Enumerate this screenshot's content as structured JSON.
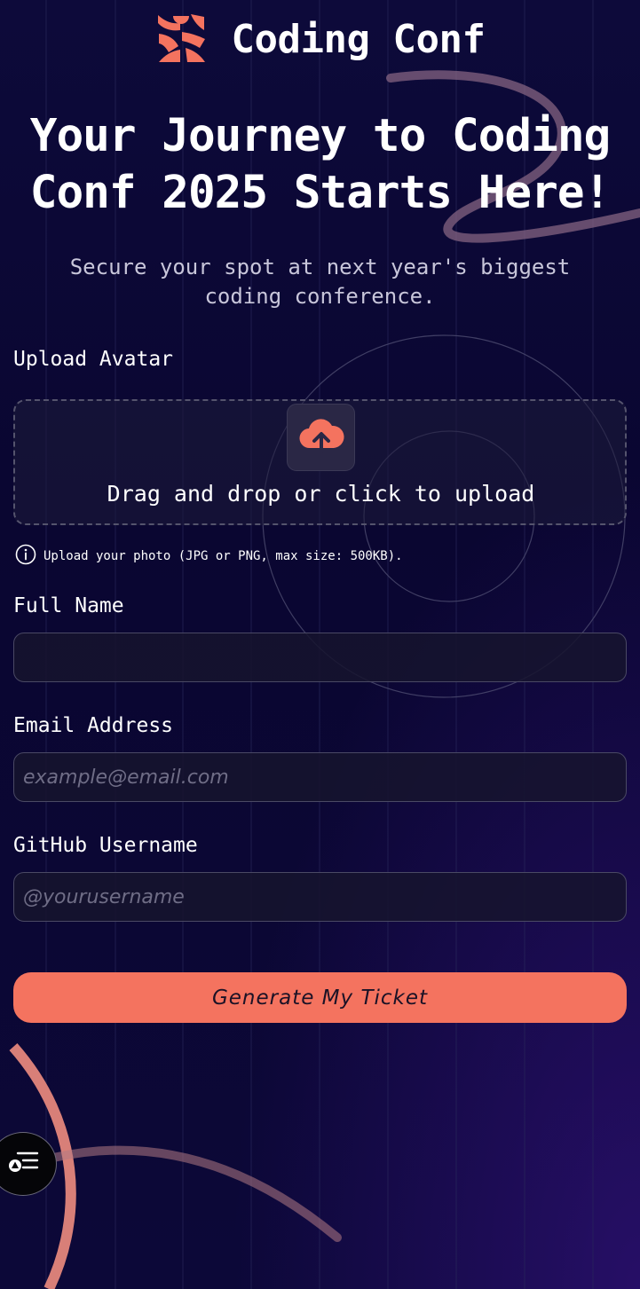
{
  "header": {
    "title": "Coding Conf",
    "logo_icon": "coding-conf-logo"
  },
  "hero": {
    "headline": "Your Journey to Coding Conf 2025 Starts Here!",
    "subheadline": "Secure your spot at next year's biggest coding conference."
  },
  "form": {
    "avatar": {
      "label": "Upload Avatar",
      "dropzone_text": "Drag and drop or click to upload",
      "upload_icon": "cloud-upload-icon",
      "hint": "Upload your photo (JPG or PNG, max size: 500KB).",
      "hint_icon": "info-icon"
    },
    "full_name": {
      "label": "Full Name",
      "value": "",
      "placeholder": ""
    },
    "email": {
      "label": "Email Address",
      "value": "",
      "placeholder": "example@email.com"
    },
    "github": {
      "label": "GitHub Username",
      "value": "",
      "placeholder": "@yourusername"
    },
    "submit_label": "Generate My Ticket"
  },
  "floating_button": {
    "icon": "menu-icon"
  },
  "colors": {
    "accent": "#f4735f",
    "background": "#0b0735",
    "input_bg": "#16142e",
    "border": "#4a4964"
  }
}
